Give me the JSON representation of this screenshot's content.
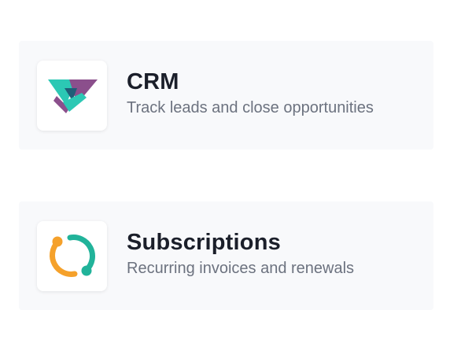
{
  "apps": [
    {
      "name": "CRM",
      "description": "Track leads and close opportunities",
      "icon": "handshake-icon",
      "colors": {
        "teal": "#2cc8b4",
        "purple": "#8b4f8c",
        "dark": "#1f5e78"
      }
    },
    {
      "name": "Subscriptions",
      "description": "Recurring invoices and renewals",
      "icon": "recurring-cycle-icon",
      "colors": {
        "orange": "#f5a12b",
        "teal": "#21b39a"
      }
    }
  ]
}
